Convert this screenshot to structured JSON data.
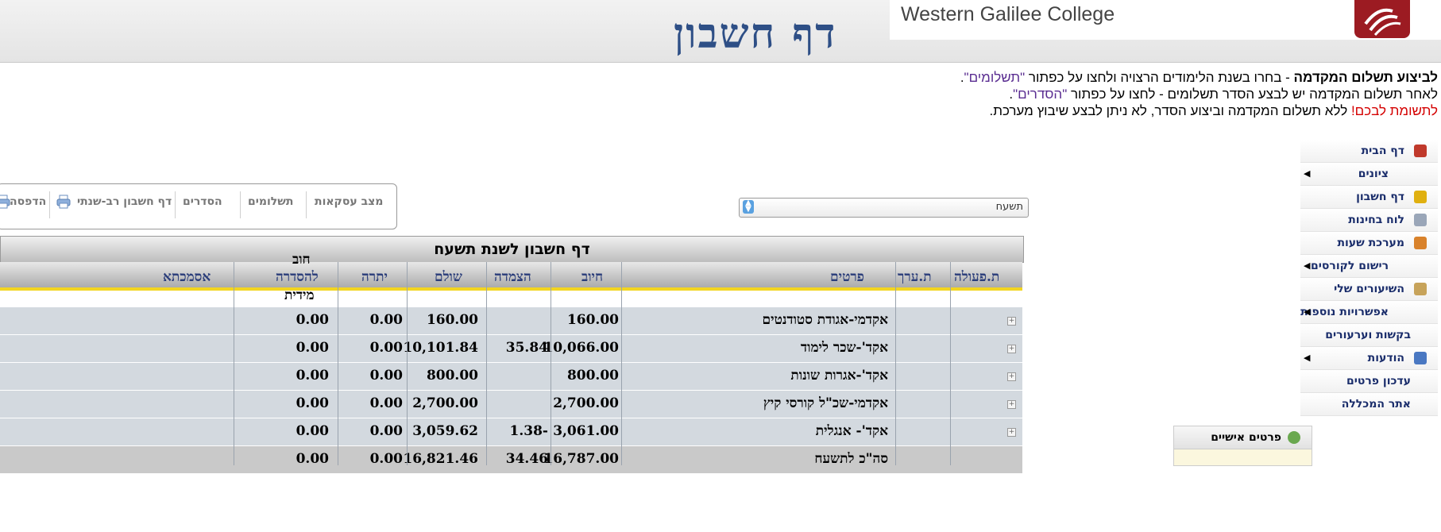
{
  "header": {
    "page_title": "דף חשבון",
    "college_name": "Western Galilee College"
  },
  "instructions": {
    "line1_bold": "לביצוע תשלום המקדמה",
    "line1_rest": " - בחרו בשנת הלימודים הרצויה ולחצו על כפתור ",
    "line1_q": "\"תשלומים\"",
    "line1_end": ".",
    "line2_start": "לאחר תשלום המקדמה יש לבצע הסדר תשלומים - לחצו על כפתור ",
    "line2_q": "\"הסדרים\"",
    "line2_end": ".",
    "line3_red": "לתשומת לבכם!",
    "line3_rest": " ללא תשלום המקדמה וביצוע הסדר, לא ניתן לבצע שיבוץ מערכת."
  },
  "year_select": {
    "value": "תשעח"
  },
  "toolbar": {
    "transactions": "מצב עסקאות",
    "payments": "תשלומים",
    "arrangements": "הסדרים",
    "multi_year": "דף חשבון רב-שנתי",
    "print": "הדפסה"
  },
  "sidebar": {
    "items": [
      {
        "label": "דף הבית",
        "icon": "home-globe-icon",
        "arrow": false
      },
      {
        "label": "ציונים",
        "icon": "",
        "arrow": true
      },
      {
        "label": "דף חשבון",
        "icon": "coin-icon",
        "arrow": false
      },
      {
        "label": "לוח בחינות",
        "icon": "exam-icon",
        "arrow": false
      },
      {
        "label": "מערכת שעות",
        "icon": "calendar-icon",
        "arrow": false
      },
      {
        "label": "רישום לקורסים",
        "icon": "",
        "arrow": true
      },
      {
        "label": "השיעורים שלי",
        "icon": "lessons-icon",
        "arrow": false
      },
      {
        "label": "אפשרויות נוספות",
        "icon": "",
        "arrow": true
      },
      {
        "label": "בקשות וערעורים",
        "icon": "",
        "arrow": false
      },
      {
        "label": "הודעות",
        "icon": "messages-icon",
        "arrow": true
      },
      {
        "label": "עדכון פרטים",
        "icon": "",
        "arrow": false
      },
      {
        "label": "אתר המכללה",
        "icon": "",
        "arrow": false
      }
    ],
    "personal_details": "פרטים אישיים"
  },
  "table": {
    "title": "דף חשבון לשנת תשעח",
    "headers": {
      "action_no": "ת.פעולה",
      "value_date": "ת.ערך",
      "details": "פרטים",
      "charge": "חיוב",
      "linkage": "הצמדה",
      "paid": "שולם",
      "balance": "יתרה",
      "debt_line1": "חוב",
      "debt_line2": "להסדרה",
      "debt_line3": "מידית",
      "reference": "אסמכתא"
    },
    "rows": [
      {
        "details": "אקדמי-אגודת סטודנטים",
        "charge": "160.00",
        "linkage": "",
        "paid": "160.00",
        "balance": "0.00",
        "debt": "0.00"
      },
      {
        "details": "אקד'-שכר לימוד",
        "charge": "10,066.00",
        "linkage": "35.84",
        "paid": "10,101.84",
        "balance": "0.00",
        "debt": "0.00"
      },
      {
        "details": "אקד'-אגרות שונות",
        "charge": "800.00",
        "linkage": "",
        "paid": "800.00",
        "balance": "0.00",
        "debt": "0.00"
      },
      {
        "details": "אקדמי-שכ\"ל קורסי קיץ",
        "charge": "2,700.00",
        "linkage": "",
        "paid": "2,700.00",
        "balance": "0.00",
        "debt": "0.00"
      },
      {
        "details": "אקד'- אנגלית",
        "charge": "3,061.00",
        "linkage": "1.38-",
        "paid": "3,059.62",
        "balance": "0.00",
        "debt": "0.00"
      }
    ],
    "total": {
      "details": "סה\"כ לתשעח",
      "charge": "16,787.00",
      "linkage": "34.46",
      "paid": "16,821.46",
      "balance": "0.00",
      "debt": "0.00"
    }
  }
}
